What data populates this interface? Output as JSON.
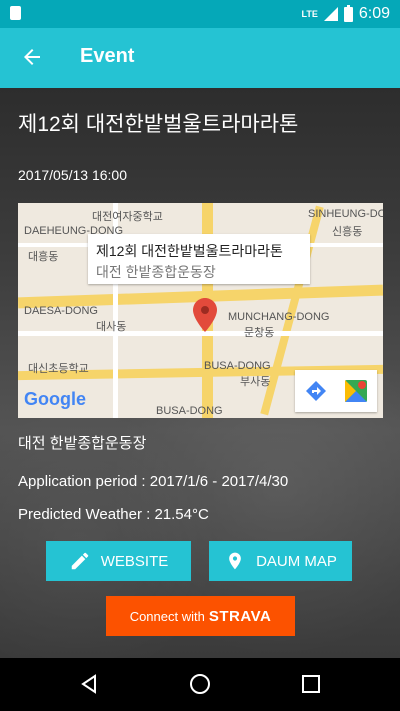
{
  "status_bar": {
    "network": "LTE",
    "time": "6:09"
  },
  "app_bar": {
    "title": "Event"
  },
  "event": {
    "title": "제12회 대전한밭벌울트라마라톤",
    "datetime": "2017/05/13 16:00",
    "venue": "대전 한밭종합운동장",
    "application_period": "Application period : 2017/1/6 - 2017/4/30",
    "predicted_weather": "Predicted Weather : 21.54°C"
  },
  "map": {
    "callout_title": "제12회 대전한밭벌울트라마라톤",
    "callout_subtitle": "대전 한밭종합운동장",
    "labels": {
      "daejeon_girls_middle": "대전여자중학교",
      "daeheung_dong": "DAEHEUNG-DONG",
      "daeheung_dong_ko": "대흥동",
      "sinheung_dong": "SINHEUNG-DO",
      "sinheung_dong_ko": "신흥동",
      "daesa_dong": "DAESA-DONG",
      "daesa_dong_ko": "대사동",
      "munchang_dong": "MUNCHANG-DONG",
      "munchang_dong_ko": "문창동",
      "busa_dong": "BUSA-DONG",
      "busa_dong_ko": "부사동",
      "busa_dong_bottom": "BUSA-DONG",
      "daeshin_elementary": "대신초등학교"
    },
    "google_logo": "Google"
  },
  "buttons": {
    "website": "WEBSITE",
    "daum_map": "DAUM MAP",
    "strava_prefix": "Connect with",
    "strava_brand": "STRAVA"
  },
  "colors": {
    "teal": "#25c3d3",
    "status_teal": "#05a8b8",
    "strava_orange": "#fc5200"
  },
  "icons": [
    "back-arrow-icon",
    "sd-card-icon",
    "signal-icon",
    "battery-icon",
    "map-pin-icon",
    "directions-icon",
    "google-maps-icon",
    "pencil-icon",
    "location-pin-icon",
    "nav-back-icon",
    "nav-home-icon",
    "nav-recents-icon"
  ]
}
